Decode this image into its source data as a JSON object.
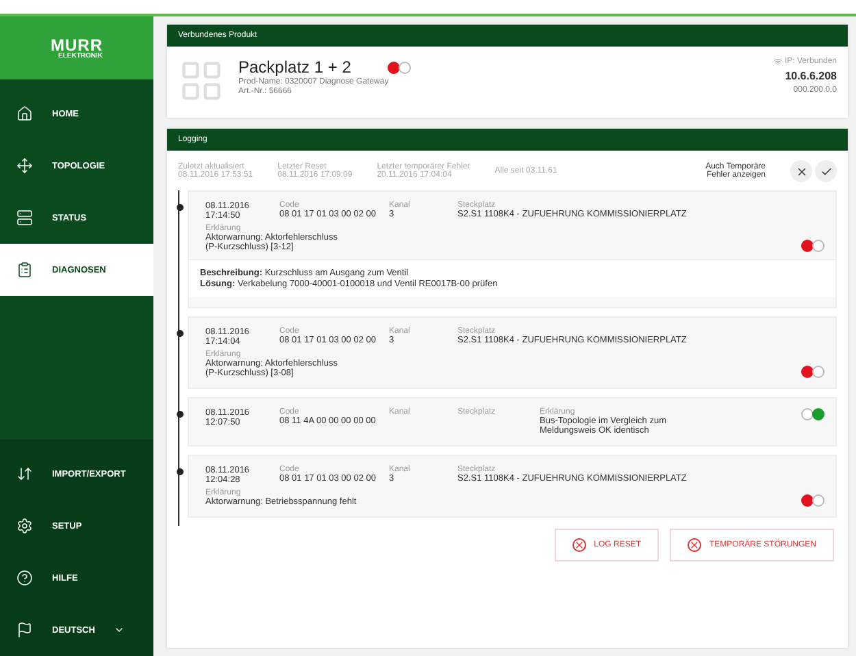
{
  "logo": {
    "brand": "MURR",
    "sub": "ELEKTRONIK"
  },
  "nav": {
    "top": [
      {
        "label": "HOME",
        "selected": false
      },
      {
        "label": "TOPOLOGIE",
        "selected": false
      },
      {
        "label": "STATUS",
        "selected": false
      },
      {
        "label": "DIAGNOSEN",
        "selected": true
      }
    ],
    "bottom": [
      {
        "label": "IMPORT/EXPORT",
        "selected": false
      },
      {
        "label": "SETUP",
        "selected": false
      },
      {
        "label": "HILFE",
        "selected": false
      }
    ]
  },
  "language": {
    "label": "DEUTSCH"
  },
  "product": {
    "header": "Verbundenes Produkt",
    "name": "Packplatz 1 + 2",
    "error": true,
    "details": [
      "Prod-Name: 0320007 Diagnose Gateway",
      "Art.-Nr.: 56666"
    ],
    "connection": "IP: Verbunden",
    "ip": "10.6.6.208",
    "version": "000.200.0.0"
  },
  "logging": {
    "header": "Logging",
    "filters": [
      {
        "label": "Zuletzt aktualisiert",
        "value": "08.11.2016 17:53:51"
      },
      {
        "label": "Letzter Reset",
        "value": "08.11.2016 17:09:09"
      },
      {
        "label": "Letzter temporärer Fehler",
        "value": "20.11.2016 17:04:04"
      },
      {
        "label": "Alle seit 03.11.61"
      }
    ],
    "temp_toggle": "Auch Temporäre Fehler anzeigen",
    "entries": [
      {
        "date": "08.11.2016",
        "time": "17:14:50",
        "error": true,
        "columns": [
          {
            "label": "Code",
            "lines": [
              "08 01 17 01 03 00 02 00"
            ]
          },
          {
            "label": "Kanal",
            "lines": [
              "3"
            ]
          },
          {
            "label": "Steckplatz",
            "lines": [
              "S2.S1 1108K4 - ZUFUEHRUNG KOMMISSIONIERPLATZ"
            ]
          }
        ],
        "explanation": {
          "label": "Erklärung",
          "lines": [
            "Aktorwarnung: Aktorfehlerschluss",
            "(P-Kurzschluss) [3-12]"
          ]
        },
        "detail": [
          "**Beschreibung:** Kurzschluss am Ausgang zum Ventil",
          "**Lösung:** Verkabelung 7000-40001-0100018 und Ventil RE0017B-00 prüfen"
        ]
      },
      {
        "date": "08.11.2016",
        "time": "17:14:04",
        "error": true,
        "columns": [
          {
            "label": "Code",
            "lines": [
              "08 01 17 01 03 00 02 00"
            ]
          },
          {
            "label": "Kanal",
            "lines": [
              "3"
            ]
          },
          {
            "label": "Steckplatz",
            "lines": [
              "S2.S1 1108K4 - ZUFUEHRUNG KOMMISSIONIERPLATZ"
            ]
          }
        ],
        "explanation": {
          "label": "Erklärung",
          "lines": [
            "Aktorwarnung: Aktorfehlerschluss",
            "(P-Kurzschluss) [3-08]"
          ]
        }
      },
      {
        "date": "08.11.2016",
        "time": "12:07:50",
        "error": false,
        "columns": [
          {
            "label": "Code",
            "lines": [
              "08 11 4A 00 00 00 00 00"
            ]
          },
          {
            "label": "Kanal"
          },
          {
            "label": "Steckplatz"
          },
          {
            "label": "Erklärung",
            "lines": [
              "Bus-Topologie im Vergleich zum",
              "Meldungsweis OK identisch"
            ]
          }
        ]
      },
      {
        "date": "08.11.2016",
        "time": "12:04:28",
        "error": true,
        "columns": [
          {
            "label": "Code",
            "lines": [
              "08 01 17 01 03 00 02 00"
            ]
          },
          {
            "label": "Kanal",
            "lines": [
              "3"
            ]
          },
          {
            "label": "Steckplatz",
            "lines": [
              "S2.S1 1108K4 - ZUFUEHRUNG KOMMISSIONIERPLATZ"
            ]
          }
        ],
        "explanation": {
          "label": "Erklärung",
          "lines": [
            "Aktorwarnung: Betriebsspannung fehlt"
          ]
        }
      }
    ],
    "buttons": [
      "LOG RESET",
      "TEMPORÄRE STÖRUNGEN"
    ]
  }
}
